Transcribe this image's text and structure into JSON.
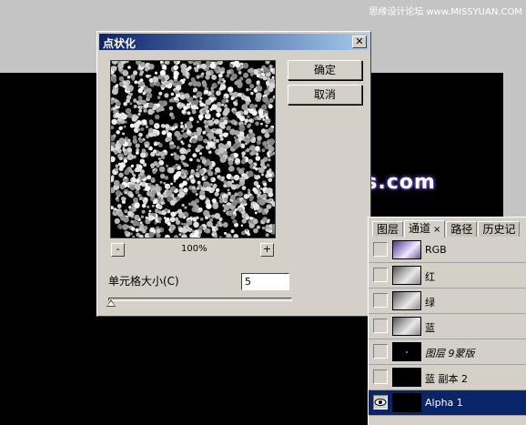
{
  "watermark_top": "思缘设计论坛 www.MISSYUAN.COM",
  "watermark_mid": "www.68ps.com",
  "dialog": {
    "title": "点状化",
    "close_glyph": "✕",
    "ok_label": "确定",
    "cancel_label": "取消",
    "zoom_out_label": "-",
    "zoom_in_label": "+",
    "zoom_level": "100%",
    "cell_size_label": "单元格大小(C)",
    "cell_size_value": "5",
    "cell_size_slider_fraction": 0.0
  },
  "panel": {
    "tabs": [
      {
        "label": "图层",
        "active": false
      },
      {
        "label": "通道",
        "active": true,
        "close": "×"
      },
      {
        "label": "路径",
        "active": false
      },
      {
        "label": "历史记",
        "active": false
      }
    ],
    "channels": [
      {
        "name": "RGB",
        "thumb": "rgb",
        "visible": false,
        "selected": false
      },
      {
        "name": "红",
        "thumb": "gray",
        "visible": false,
        "selected": false
      },
      {
        "name": "绿",
        "thumb": "gray",
        "visible": false,
        "selected": false
      },
      {
        "name": "蓝",
        "thumb": "gray",
        "visible": false,
        "selected": false
      },
      {
        "name": "图层 9蒙版",
        "thumb": "dark",
        "visible": false,
        "selected": false
      },
      {
        "name": "蓝 副本 2",
        "thumb": "dark",
        "visible": false,
        "selected": false
      },
      {
        "name": "Alpha 1",
        "thumb": "dark",
        "visible": true,
        "selected": true
      }
    ]
  },
  "colors": {
    "titlebar_start": "#0a246a",
    "titlebar_end": "#a6caf0",
    "selection": "#0a246a",
    "dialog_bg": "#d4d0c8"
  }
}
